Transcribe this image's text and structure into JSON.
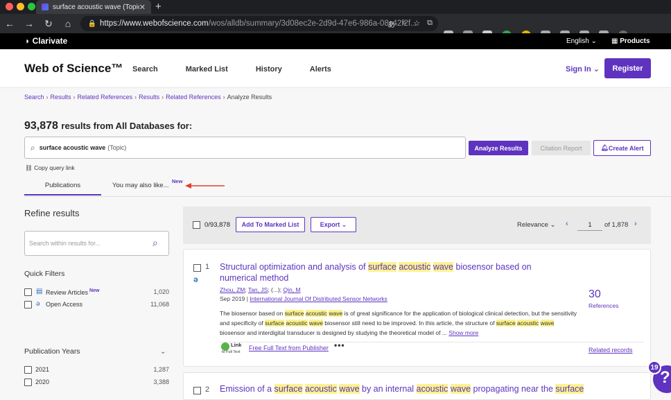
{
  "browser": {
    "tab_title": "surface acoustic wave (Topic)",
    "url_host": "https://www.webofscience.com",
    "url_path": "/wos/alldb/summary/3d08ec2e-2d9d-47e6-986a-08c42f2f..."
  },
  "clarivate": {
    "logo": "Clarivate",
    "language": "English",
    "products": "Products"
  },
  "header": {
    "logo": "Web of Science™",
    "nav": [
      "Search",
      "Marked List",
      "History",
      "Alerts"
    ],
    "sign_in": "Sign In",
    "register": "Register"
  },
  "breadcrumb": [
    "Search",
    "Results",
    "Related References",
    "Results",
    "Related References",
    "Analyze Results"
  ],
  "results_header": {
    "count": "93,878",
    "text": "results from All Databases for:"
  },
  "search": {
    "query": "surface acoustic wave",
    "field": "(Topic)",
    "analyze_label": "Analyze Results",
    "citation_label": "Citation Report",
    "alert_label": "Create Alert",
    "copy_link": "Copy query link"
  },
  "tabs": {
    "publications": "Publications",
    "you_may_like": "You may also like...",
    "new_badge": "New"
  },
  "sidebar": {
    "refine_title": "Refine results",
    "refine_placeholder": "Search within results for...",
    "quick_filters_title": "Quick Filters",
    "quick_filters": [
      {
        "label": "Review Articles",
        "count": "1,020",
        "badge": "New"
      },
      {
        "label": "Open Access",
        "count": "11,068"
      }
    ],
    "pub_years_title": "Publication Years",
    "pub_years": [
      {
        "label": "2021",
        "count": "1,287"
      },
      {
        "label": "2020",
        "count": "3,388"
      }
    ]
  },
  "toolbar": {
    "selected": "0/93,878",
    "add_marked": "Add To Marked List",
    "export": "Export",
    "sort": "Relevance",
    "page": "1",
    "of_pages": "of  1,878"
  },
  "records": [
    {
      "num": "1",
      "title_parts": [
        "Structural optimization and analysis of ",
        "surface",
        " ",
        "acoustic",
        " ",
        "wave",
        " biosensor based on numerical method"
      ],
      "authors": [
        "Zhou, ZM",
        "Tan, JS",
        "(...)",
        "Qin, M"
      ],
      "date": "Sep 2019",
      "journal": "International Journal Of Distributed Sensor Networks",
      "abstract_a": "The biosensor based on ",
      "abstract_b": " is of great significance for the application of biological clinical detection, but the sensitivity and specificity of ",
      "abstract_c": " biosensor still need to be improved. In this article, the structure of ",
      "abstract_d": " biosensor and interdigital transducer is designed by studying the theoretical model of  ...",
      "show_more": "Show more",
      "hl": [
        "surface",
        "acoustic",
        "wave"
      ],
      "citations": "30",
      "citations_label": "References",
      "link_label_1": "Link",
      "link_label_2": "to Full Text",
      "full_text": "Free Full Text from Publisher",
      "more": "•••",
      "related": "Related records"
    },
    {
      "num": "2",
      "title_parts": [
        "Emission of a ",
        "surface",
        " ",
        "acoustic",
        " ",
        "wave",
        " by an internal ",
        "acoustic",
        " ",
        "wave",
        " propagating near the ",
        "surface"
      ]
    }
  ],
  "help": {
    "count": "19",
    "icon": "?"
  }
}
